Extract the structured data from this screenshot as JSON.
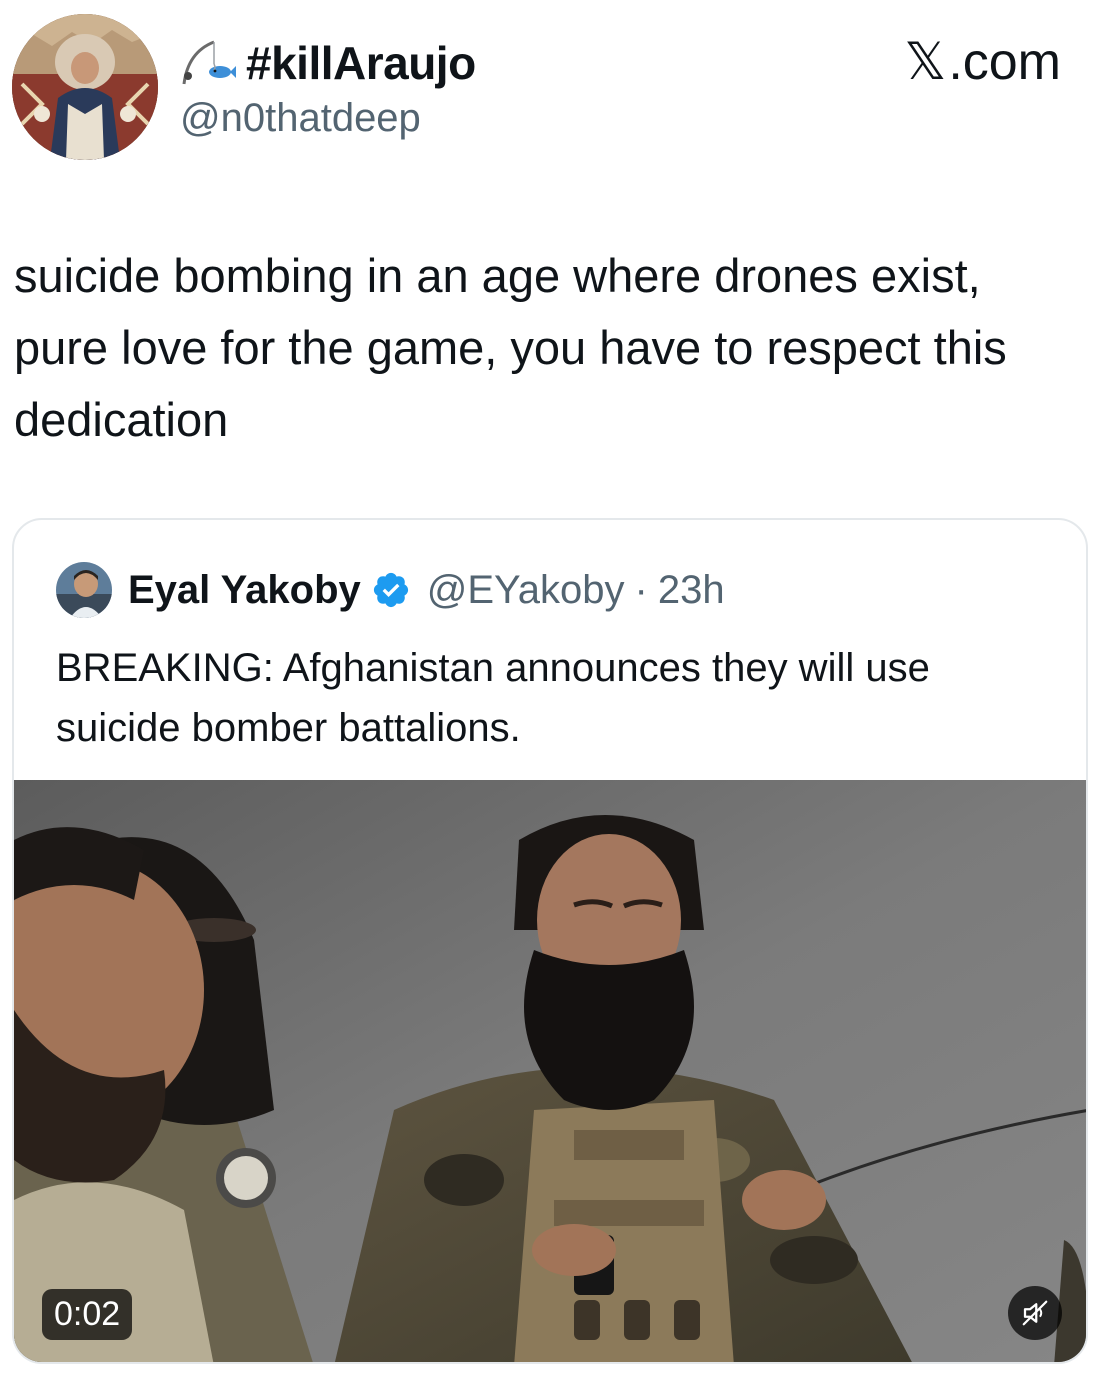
{
  "post": {
    "display_name": "#killAraujo",
    "name_emoji_icon": "fishing-pole-fish-icon",
    "handle": "@n0thatdeep",
    "site_label": "X.com",
    "site_glyph": "𝕏",
    "site_suffix": ".com",
    "text": "suicide bombing in an age where drones exist, pure love for the game, you have to respect this dedication"
  },
  "quoted_post": {
    "display_name": "Eyal Yakoby",
    "verified": true,
    "verified_icon": "verified-badge-icon",
    "verified_color": "#1d9bf0",
    "handle": "@EYakoby",
    "separator": "·",
    "time": "23h",
    "text": "BREAKING: Afghanistan announces they will use suicide bomber battalions.",
    "media": {
      "type": "video",
      "duration": "0:02",
      "mute_icon": "speaker-muted-icon"
    }
  },
  "colors": {
    "text_primary": "#0f1419",
    "text_secondary": "#536471",
    "card_border": "#e4e8eb",
    "verified_blue": "#1d9bf0"
  }
}
